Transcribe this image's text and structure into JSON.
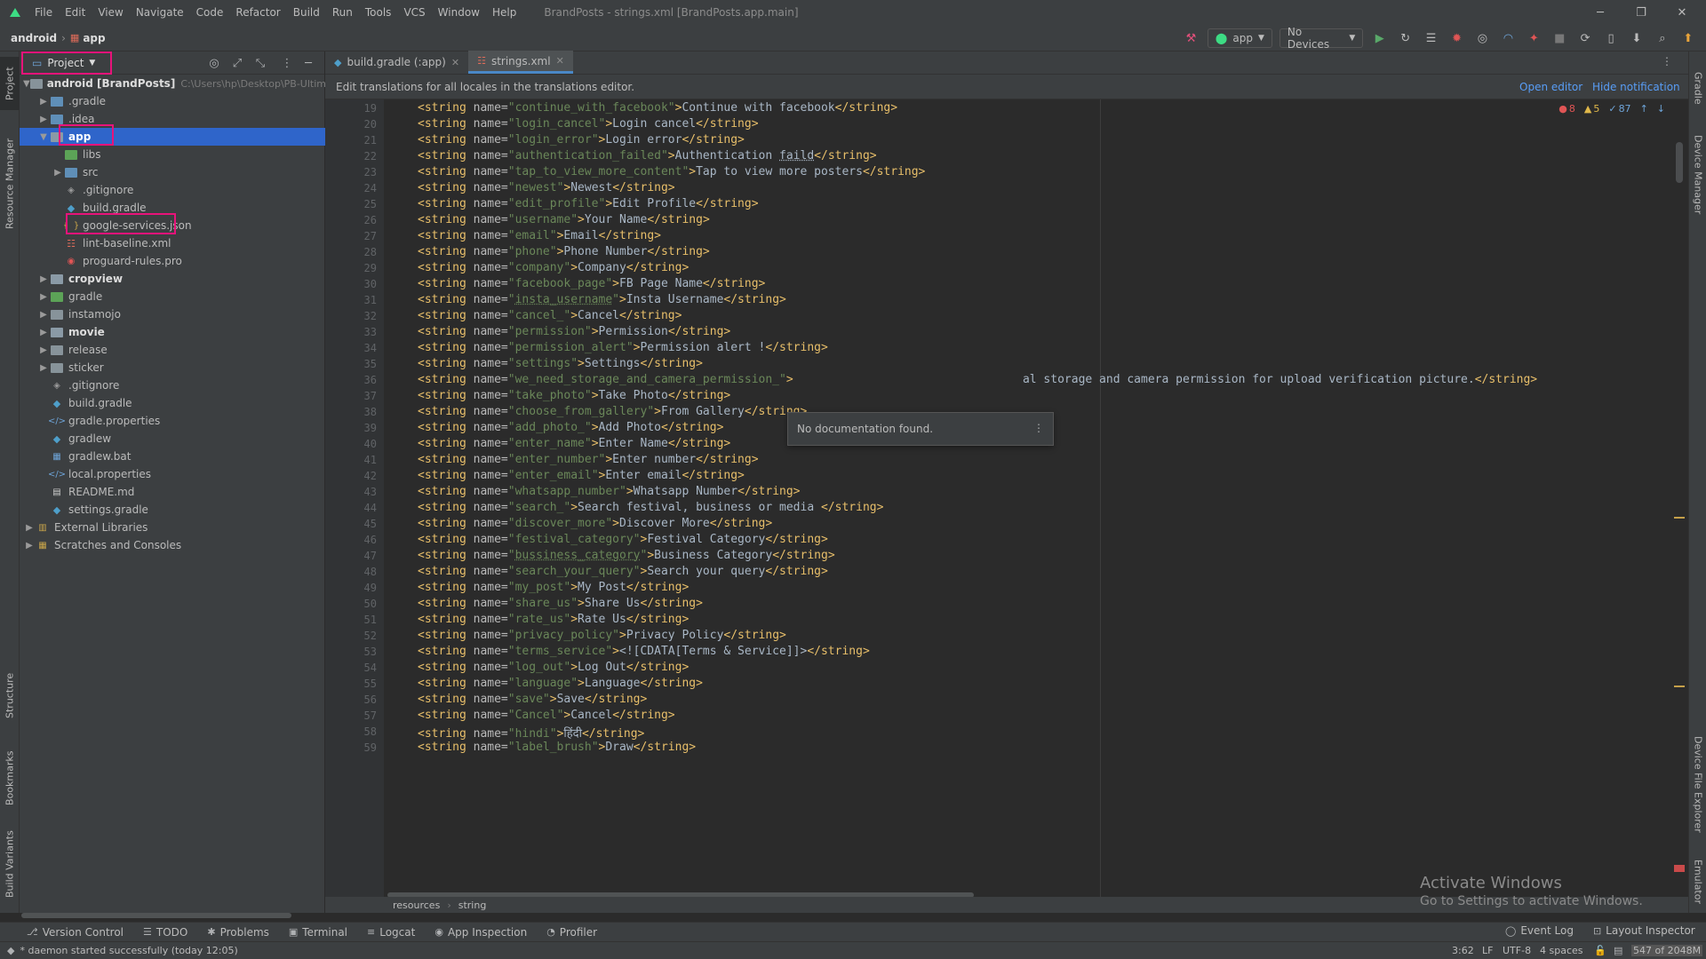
{
  "menubar": {
    "items": [
      {
        "label": "File"
      },
      {
        "label": "Edit"
      },
      {
        "label": "View"
      },
      {
        "label": "Navigate"
      },
      {
        "label": "Code"
      },
      {
        "label": "Refactor"
      },
      {
        "label": "Build"
      },
      {
        "label": "Run"
      },
      {
        "label": "Tools"
      },
      {
        "label": "VCS"
      },
      {
        "label": "Window"
      },
      {
        "label": "Help"
      }
    ],
    "window_title": "BrandPosts - strings.xml [BrandPosts.app.main]"
  },
  "navbar": {
    "crumb_root": "android",
    "crumb_sep": "›",
    "crumb_module": "app",
    "run_config": "app",
    "device": "No Devices"
  },
  "project_panel": {
    "view_label": "Project",
    "tree": [
      {
        "indent": 0,
        "arrow": "▼",
        "icon": "folder",
        "label": "android [BrandPosts]",
        "hint": "C:\\Users\\hp\\Desktop\\PB-Ultimate\\",
        "bold": true
      },
      {
        "indent": 1,
        "arrow": "▶",
        "icon": "folder-blue",
        "label": ".gradle"
      },
      {
        "indent": 1,
        "arrow": "▶",
        "icon": "folder-blue",
        "label": ".idea"
      },
      {
        "indent": 1,
        "arrow": "▼",
        "icon": "folder-module",
        "label": "app",
        "bold": true,
        "selected": true
      },
      {
        "indent": 2,
        "arrow": "",
        "icon": "folder-green",
        "label": "libs"
      },
      {
        "indent": 2,
        "arrow": "▶",
        "icon": "folder-blue",
        "label": "src"
      },
      {
        "indent": 2,
        "arrow": "",
        "icon": "gitignore",
        "label": ".gitignore"
      },
      {
        "indent": 2,
        "arrow": "",
        "icon": "gradle",
        "label": "build.gradle"
      },
      {
        "indent": 2,
        "arrow": "",
        "icon": "json",
        "label": "google-services.json"
      },
      {
        "indent": 2,
        "arrow": "",
        "icon": "xml",
        "label": "lint-baseline.xml"
      },
      {
        "indent": 2,
        "arrow": "",
        "icon": "proguard",
        "label": "proguard-rules.pro"
      },
      {
        "indent": 1,
        "arrow": "▶",
        "icon": "folder-module",
        "label": "cropview",
        "bold": true
      },
      {
        "indent": 1,
        "arrow": "▶",
        "icon": "folder-green",
        "label": "gradle"
      },
      {
        "indent": 1,
        "arrow": "▶",
        "icon": "folder",
        "label": "instamojo"
      },
      {
        "indent": 1,
        "arrow": "▶",
        "icon": "folder-module",
        "label": "movie",
        "bold": true
      },
      {
        "indent": 1,
        "arrow": "▶",
        "icon": "folder",
        "label": "release"
      },
      {
        "indent": 1,
        "arrow": "▶",
        "icon": "folder",
        "label": "sticker"
      },
      {
        "indent": 1,
        "arrow": "",
        "icon": "gitignore",
        "label": ".gitignore"
      },
      {
        "indent": 1,
        "arrow": "",
        "icon": "gradle",
        "label": "build.gradle"
      },
      {
        "indent": 1,
        "arrow": "",
        "icon": "properties",
        "label": "gradle.properties"
      },
      {
        "indent": 1,
        "arrow": "",
        "icon": "gradle",
        "label": "gradlew"
      },
      {
        "indent": 1,
        "arrow": "",
        "icon": "bat",
        "label": "gradlew.bat"
      },
      {
        "indent": 1,
        "arrow": "",
        "icon": "properties",
        "label": "local.properties"
      },
      {
        "indent": 1,
        "arrow": "",
        "icon": "md",
        "label": "README.md"
      },
      {
        "indent": 1,
        "arrow": "",
        "icon": "gradle",
        "label": "settings.gradle"
      },
      {
        "indent": 0,
        "arrow": "▶",
        "icon": "libraries",
        "label": "External Libraries"
      },
      {
        "indent": 0,
        "arrow": "▶",
        "icon": "scratches",
        "label": "Scratches and Consoles"
      }
    ]
  },
  "editor_tabs": [
    {
      "label": "build.gradle (:app)",
      "active": false
    },
    {
      "label": "strings.xml",
      "active": true
    }
  ],
  "notification": {
    "text": "Edit translations for all locales in the translations editor.",
    "open_editor": "Open editor",
    "hide": "Hide notification"
  },
  "inspections": {
    "errors": "8",
    "warnings": "5",
    "weak": "87"
  },
  "code_lines": [
    {
      "n": "19",
      "name": "continue_with_facebook",
      "value": "Continue with facebook"
    },
    {
      "n": "20",
      "name": "login_cancel",
      "value": "Login cancel"
    },
    {
      "n": "21",
      "name": "login_error",
      "value": "Login error"
    },
    {
      "n": "22",
      "name": "authentication_failed",
      "value": "Authentication faild"
    },
    {
      "n": "23",
      "name": "tap_to_view_more_content",
      "value": "Tap to view more posters"
    },
    {
      "n": "24",
      "name": "newest",
      "value": "Newest"
    },
    {
      "n": "25",
      "name": "edit_profile",
      "value": "Edit Profile"
    },
    {
      "n": "26",
      "name": "username",
      "value": "Your Name"
    },
    {
      "n": "27",
      "name": "email",
      "value": "Email"
    },
    {
      "n": "28",
      "name": "phone",
      "value": "Phone Number"
    },
    {
      "n": "29",
      "name": "company",
      "value": "Company"
    },
    {
      "n": "30",
      "name": "facebook_page",
      "value": "FB Page Name"
    },
    {
      "n": "31",
      "name": "insta_username",
      "value": "Insta Username"
    },
    {
      "n": "32",
      "name": "cancel_",
      "value": "Cancel"
    },
    {
      "n": "33",
      "name": "permission",
      "value": "Permission"
    },
    {
      "n": "34",
      "name": "permission_alert",
      "value": "Permission alert !"
    },
    {
      "n": "35",
      "name": "settings",
      "value": "Settings"
    },
    {
      "n": "36",
      "name": "we_need_storage_and_camera_permission_",
      "value": "                                 al storage and camera permission for upload verification picture."
    },
    {
      "n": "37",
      "name": "take_photo",
      "value": "Take Photo"
    },
    {
      "n": "38",
      "name": "choose_from_gallery",
      "value": "From Gallery"
    },
    {
      "n": "39",
      "name": "add_photo_",
      "value": "Add Photo"
    },
    {
      "n": "40",
      "name": "enter_name",
      "value": "Enter Name"
    },
    {
      "n": "41",
      "name": "enter_number",
      "value": "Enter number"
    },
    {
      "n": "42",
      "name": "enter_email",
      "value": "Enter email"
    },
    {
      "n": "43",
      "name": "whatsapp_number",
      "value": "Whatsapp Number"
    },
    {
      "n": "44",
      "name": "search_",
      "value": "Search festival, business or media "
    },
    {
      "n": "45",
      "name": "discover_more",
      "value": "Discover More"
    },
    {
      "n": "46",
      "name": "festival_category",
      "value": "Festival Category"
    },
    {
      "n": "47",
      "name": "bussiness_category",
      "value": "Business Category"
    },
    {
      "n": "48",
      "name": "search_your_query",
      "value": "Search your query"
    },
    {
      "n": "49",
      "name": "my_post",
      "value": "My Post"
    },
    {
      "n": "50",
      "name": "share_us",
      "value": "Share Us"
    },
    {
      "n": "51",
      "name": "rate_us",
      "value": "Rate Us"
    },
    {
      "n": "52",
      "name": "privacy_policy",
      "value": "Privacy Policy"
    },
    {
      "n": "53",
      "name": "terms_service",
      "value": "<![CDATA[Terms & Service]]>"
    },
    {
      "n": "54",
      "name": "log_out",
      "value": "Log Out"
    },
    {
      "n": "55",
      "name": "language",
      "value": "Language"
    },
    {
      "n": "56",
      "name": "save",
      "value": "Save"
    },
    {
      "n": "57",
      "name": "Cancel",
      "value": "Cancel"
    },
    {
      "n": "58",
      "name": "hindi",
      "value": "हिंदी"
    },
    {
      "n": "59",
      "name": "label_brush",
      "value": "Draw"
    }
  ],
  "doc_popup": "No documentation found.",
  "editor_breadcrumb": [
    "resources",
    "string"
  ],
  "bottom_tools": [
    {
      "label": "Version Control",
      "icon": "⎇"
    },
    {
      "label": "TODO",
      "icon": "☰"
    },
    {
      "label": "Problems",
      "icon": "✱"
    },
    {
      "label": "Terminal",
      "icon": "▣"
    },
    {
      "label": "Logcat",
      "icon": "≡"
    },
    {
      "label": "App Inspection",
      "icon": "◉"
    },
    {
      "label": "Profiler",
      "icon": "◔"
    }
  ],
  "right_tools": [
    {
      "label": "Event Log"
    },
    {
      "label": "Layout Inspector"
    }
  ],
  "left_stripe": [
    "Project",
    "Resource Manager",
    "Structure",
    "Bookmarks",
    "Build Variants"
  ],
  "right_stripe": [
    "Gradle",
    "Device Manager",
    "Device File Explorer",
    "Emulator"
  ],
  "status": {
    "message": "* daemon started successfully (today 12:05)",
    "position": "3:62",
    "line_sep": "LF",
    "encoding": "UTF-8",
    "indent": "4 spaces",
    "memory": "547 of 2048M"
  },
  "watermark": {
    "line1": "Activate Windows",
    "line2": "Go to Settings to activate Windows."
  },
  "colors": {
    "selection": "#2f65ca",
    "highlight_box": "#e8137a",
    "accent": "#4a88c7"
  }
}
